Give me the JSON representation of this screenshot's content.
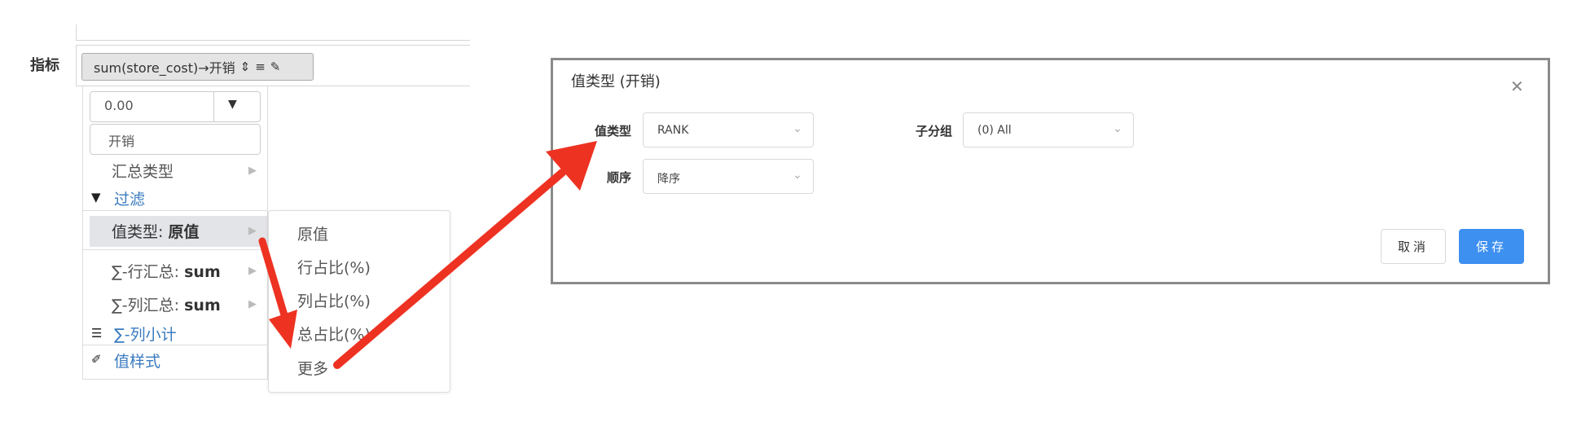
{
  "metric": {
    "label": "指标",
    "tag_text": "sum(store_cost)→开销",
    "tag_icons": [
      "sort-icon",
      "align-icon",
      "edit-icon"
    ]
  },
  "menu": {
    "format_value": "0.00",
    "alias_value": "开销",
    "items": [
      {
        "label": "汇总类型",
        "has_submenu": true
      },
      {
        "label": "过滤",
        "icon": "filter-icon",
        "link": true
      },
      {
        "label": "值类型: ",
        "bold": "原值",
        "has_submenu": true,
        "selected": true
      },
      {
        "label": "∑-行汇总: ",
        "bold": "sum",
        "has_submenu": true
      },
      {
        "label": "∑-列汇总: ",
        "bold": "sum",
        "has_submenu": true
      },
      {
        "label": "∑-列小计",
        "icon": "indent-icon",
        "link": true
      },
      {
        "label": "值样式",
        "icon": "magic-wand-icon",
        "link": true
      }
    ]
  },
  "submenu": {
    "items": [
      "原值",
      "行占比(%)",
      "列占比(%)",
      "总占比(%)",
      "更多"
    ]
  },
  "dialog": {
    "title": "值类型 (开销)",
    "value_type_label": "值类型",
    "value_type_value": "RANK",
    "subgroup_label": "子分组",
    "subgroup_value": "(0) All",
    "order_label": "顺序",
    "order_value": "降序",
    "cancel_label": "取消",
    "save_label": "保存"
  },
  "colors": {
    "link": "#3a7bbf",
    "primary": "#3d8ff0",
    "arrow": "#ee3222"
  }
}
